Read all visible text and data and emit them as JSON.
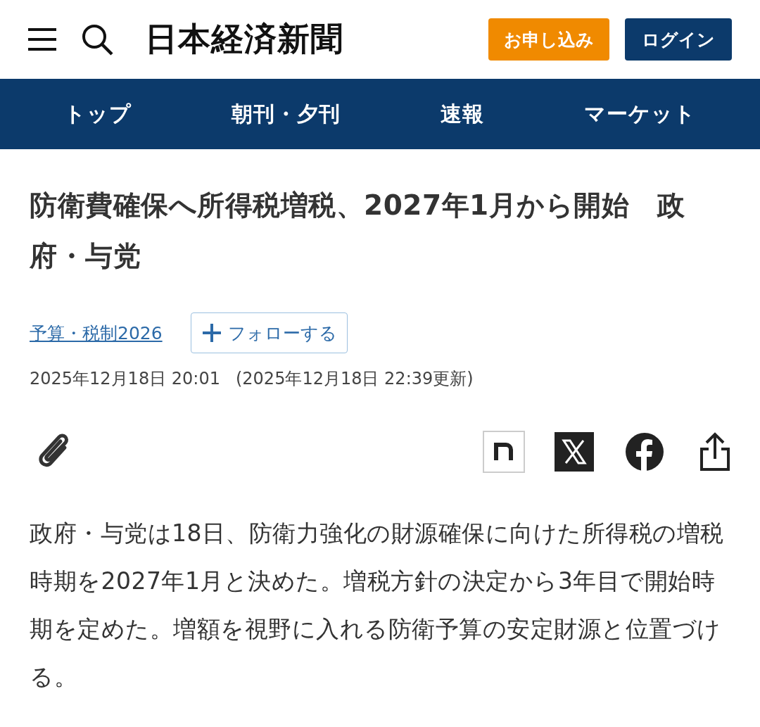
{
  "header": {
    "logo": "日本経済新聞",
    "buttons": [
      {
        "label": "お申し込み",
        "kind": "primary"
      },
      {
        "label": "ログイン",
        "kind": "secondary"
      }
    ]
  },
  "nav": [
    {
      "label": "トップ"
    },
    {
      "label": "朝刊・夕刊"
    },
    {
      "label": "速報"
    },
    {
      "label": "マーケット"
    }
  ],
  "article": {
    "title": "防衛費確保へ所得税増税、2027年1月から開始　政府・与党",
    "topic": "予算・税制2026",
    "follow": "フォローする",
    "published": "2025年12月18日 20:01",
    "updated": "(2025年12月18日 22:39更新)",
    "body": "政府・与党は18日、防衛力強化の財源確保に向けた所得税の増税時期を2027年1月と決めた。増税方針の決定から3年目で開始時期を定めた。増額を視野に入れる防衛予算の安定財源と位置づける。"
  }
}
